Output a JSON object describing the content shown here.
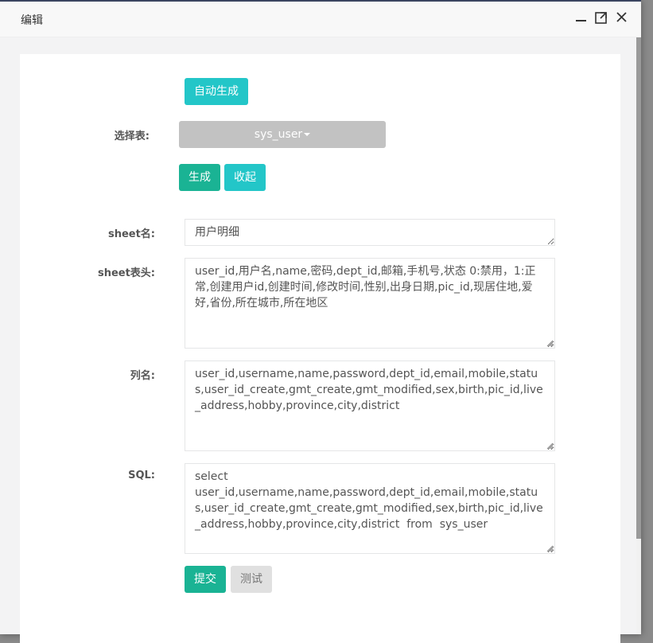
{
  "dialog": {
    "title": "编辑",
    "icons": {
      "minimize": "minimize-icon",
      "maximize": "maximize-icon",
      "close": "close-icon"
    }
  },
  "form": {
    "auto_generate_label": "自动生成",
    "select_table_label": "选择表:",
    "selected_table": "sys_user",
    "generate_label": "生成",
    "collapse_label": "收起",
    "sheet_name_label": "sheet名:",
    "sheet_name_value": "用户明细",
    "sheet_header_label": "sheet表头:",
    "sheet_header_value": "user_id,用户名,name,密码,dept_id,邮箱,手机号,状态 0:禁用，1:正常,创建用户id,创建时间,修改时间,性别,出身日期,pic_id,现居住地,爱好,省份,所在城市,所在地区",
    "columns_label": "列名:",
    "columns_value": "user_id,username,name,password,dept_id,email,mobile,status,user_id_create,gmt_create,gmt_modified,sex,birth,pic_id,live_address,hobby,province,city,district",
    "sql_label": "SQL:",
    "sql_value": "select\nuser_id,username,name,password,dept_id,email,mobile,status,user_id_create,gmt_create,gmt_modified,sex,birth,pic_id,live_address,hobby,province,city,district  from  sys_user",
    "submit_label": "提交",
    "test_label": "测试"
  },
  "colors": {
    "primary": "#1ab394",
    "info": "#23c6c8",
    "disabled_select": "#c2c2c2"
  }
}
